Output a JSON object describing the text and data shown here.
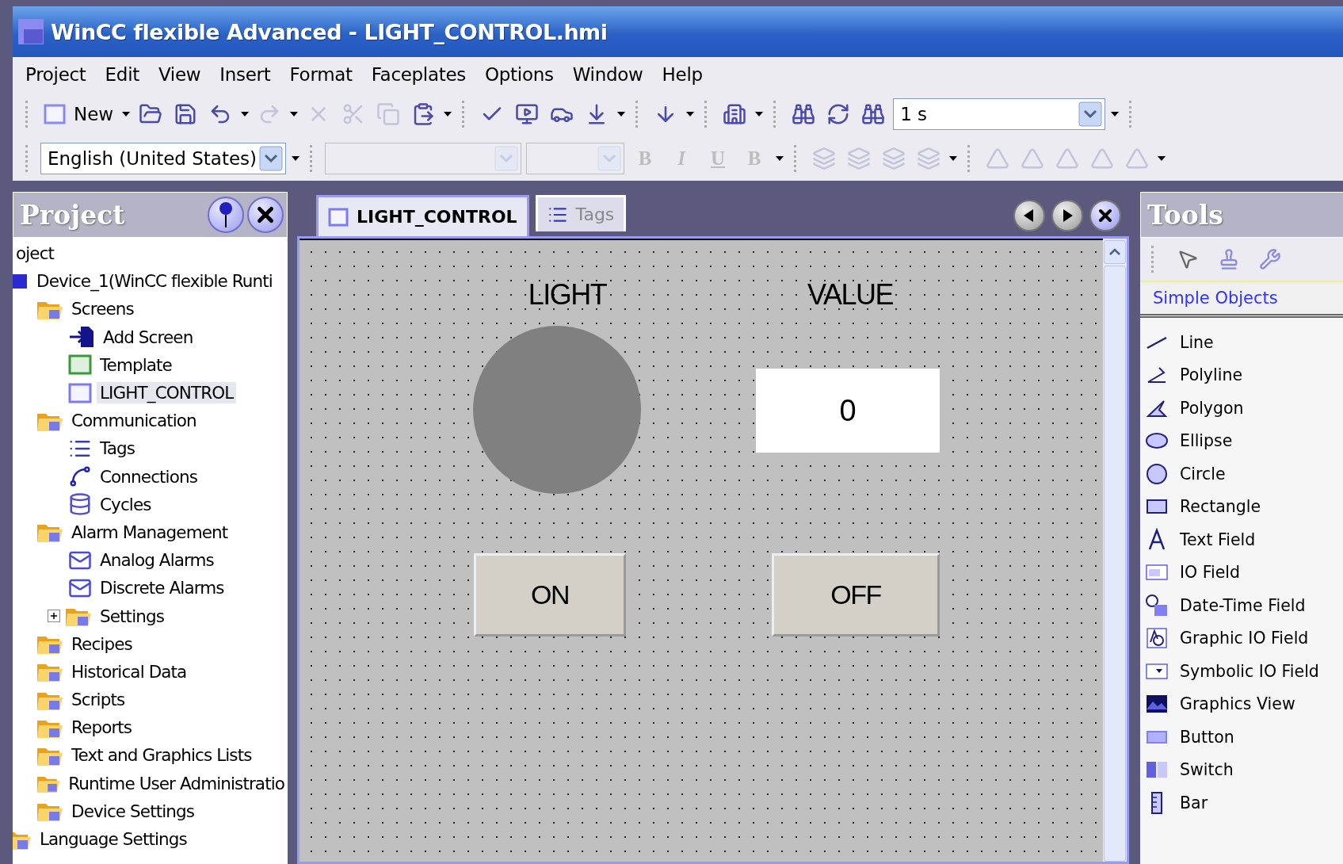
{
  "window": {
    "title": "WinCC flexible Advanced - LIGHT_CONTROL.hmi"
  },
  "menu": [
    "Project",
    "Edit",
    "View",
    "Insert",
    "Format",
    "Faceplates",
    "Options",
    "Window",
    "Help"
  ],
  "toolbar_1": {
    "new_label": "New",
    "cycle_combo": {
      "value": "1 s"
    }
  },
  "toolbar_2": {
    "language_combo": {
      "value": "English (United States)"
    },
    "font_combo": {
      "disabled": true
    },
    "size_combo": {
      "disabled": true
    },
    "format_buttons": [
      {
        "label": "B",
        "disabled": true
      },
      {
        "label": "I",
        "disabled": true
      },
      {
        "label": "U",
        "disabled": true
      },
      {
        "label": "B",
        "disabled": true
      }
    ]
  },
  "project_panel": {
    "title": "Project",
    "tree": [
      {
        "label": "oject",
        "selected": false,
        "children": [
          {
            "label": "Device_1(WinCC flexible Runti",
            "kind": "device",
            "selected": false,
            "children": [
              {
                "label": "Screens",
                "kind": "folder",
                "selected": false,
                "children": [
                  {
                    "label": "Add Screen",
                    "kind": "add",
                    "selected": false
                  },
                  {
                    "label": "Template",
                    "kind": "template",
                    "selected": false
                  },
                  {
                    "label": "LIGHT_CONTROL",
                    "kind": "screen",
                    "selected": true
                  }
                ]
              },
              {
                "label": "Communication",
                "kind": "folder",
                "selected": false,
                "children": [
                  {
                    "label": "Tags",
                    "kind": "tags",
                    "selected": false
                  },
                  {
                    "label": "Connections",
                    "kind": "connection",
                    "selected": false
                  },
                  {
                    "label": "Cycles",
                    "kind": "cycle",
                    "selected": false
                  }
                ]
              },
              {
                "label": "Alarm Management",
                "kind": "folder",
                "selected": false,
                "children": [
                  {
                    "label": "Analog Alarms",
                    "kind": "alarm",
                    "selected": false
                  },
                  {
                    "label": "Discrete Alarms",
                    "kind": "alarm",
                    "selected": false
                  },
                  {
                    "label": "Settings",
                    "kind": "folder",
                    "selected": false,
                    "expanded": false
                  }
                ]
              },
              {
                "label": "Recipes",
                "kind": "folder",
                "selected": false
              },
              {
                "label": "Historical Data",
                "kind": "folder",
                "selected": false
              },
              {
                "label": "Scripts",
                "kind": "folder",
                "selected": false
              },
              {
                "label": "Reports",
                "kind": "folder",
                "selected": false
              },
              {
                "label": "Text and Graphics Lists",
                "kind": "folder",
                "selected": false
              },
              {
                "label": "Runtime User Administratio",
                "kind": "folder",
                "selected": false
              },
              {
                "label": "Device Settings",
                "kind": "folder",
                "selected": false
              }
            ]
          },
          {
            "label": "Language Settings",
            "kind": "folder",
            "selected": false
          }
        ]
      }
    ]
  },
  "editor": {
    "tabs": [
      {
        "label": "LIGHT_CONTROL",
        "kind": "screen",
        "selected": true
      },
      {
        "label": "Tags",
        "kind": "tags",
        "selected": false
      }
    ],
    "screen": {
      "light_label": "LIGHT",
      "value_label": "VALUE",
      "indicator": {
        "on": false
      },
      "value_field": {
        "value": "0"
      },
      "buttons": [
        "ON",
        "OFF"
      ]
    }
  },
  "tools_panel": {
    "title": "Tools",
    "category": "Simple Objects",
    "items": [
      "Line",
      "Polyline",
      "Polygon",
      "Ellipse",
      "Circle",
      "Rectangle",
      "Text Field",
      "IO Field",
      "Date-Time Field",
      "Graphic IO Field",
      "Symbolic IO Field",
      "Graphics View",
      "Button",
      "Switch",
      "Bar"
    ]
  }
}
